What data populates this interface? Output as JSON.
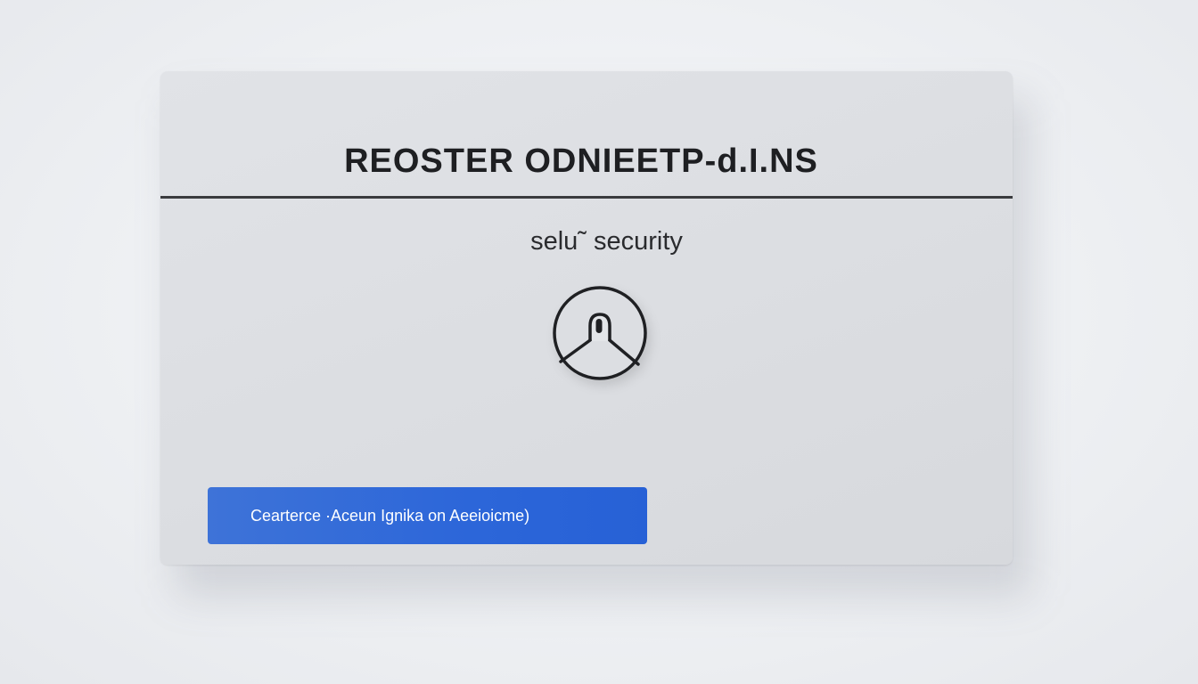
{
  "dialog": {
    "title": "REOSTER ODNIEETP-d.I.NS",
    "subtitle": "selu˜ security",
    "icon": "padlock-icon",
    "action_label": "Cearterce ·Aceun Ignika on Aeeioicme)"
  },
  "colors": {
    "button": "#2c66d9",
    "card": "#dcdee2",
    "divider": "#3a3b3e"
  }
}
